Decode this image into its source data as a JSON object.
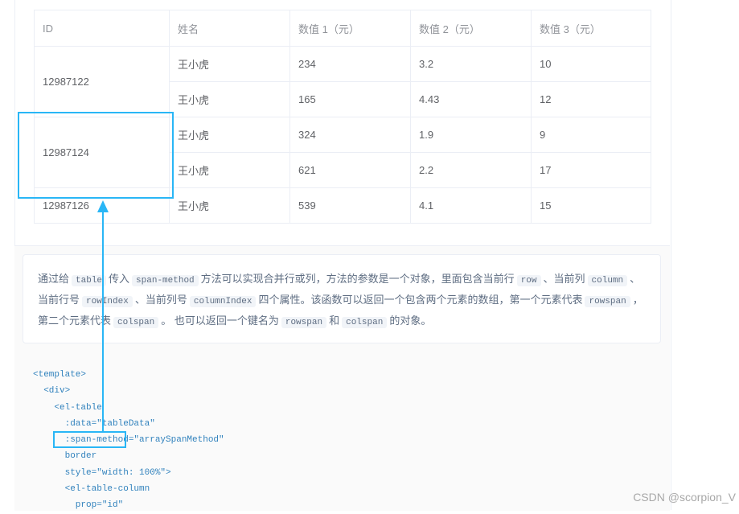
{
  "table": {
    "headers": [
      "ID",
      "姓名",
      "数值 1（元）",
      "数值 2（元）",
      "数值 3（元）"
    ],
    "groups": [
      {
        "id": "12987122",
        "rows": [
          [
            "王小虎",
            "234",
            "3.2",
            "10"
          ],
          [
            "王小虎",
            "165",
            "4.43",
            "12"
          ]
        ]
      },
      {
        "id": "12987124",
        "rows": [
          [
            "王小虎",
            "324",
            "1.9",
            "9"
          ],
          [
            "王小虎",
            "621",
            "2.2",
            "17"
          ]
        ]
      },
      {
        "id": "12987126",
        "rows": [
          [
            "王小虎",
            "539",
            "4.1",
            "15"
          ]
        ]
      }
    ]
  },
  "description": {
    "parts": [
      {
        "t": "通过给"
      },
      {
        "c": "table"
      },
      {
        "t": "传入"
      },
      {
        "c": "span-method"
      },
      {
        "t": "方法可以实现合并行或列，方法的参数是一个对象，里面包含当前行"
      },
      {
        "c": "row"
      },
      {
        "t": "、当前列"
      },
      {
        "c": "column"
      },
      {
        "t": "、当前行号"
      },
      {
        "c": "rowIndex"
      },
      {
        "t": "、当前列号"
      },
      {
        "c": "columnIndex"
      },
      {
        "t": "四个属性。该函数可以返回一个包含两个元素的数组，第一个元素代表"
      },
      {
        "c": "rowspan"
      },
      {
        "t": "，第二个元素代表"
      },
      {
        "c": "colspan"
      },
      {
        "t": "。 也可以返回一个键名为"
      },
      {
        "c": "rowspan"
      },
      {
        "t": "和"
      },
      {
        "c": "colspan"
      },
      {
        "t": "的对象。"
      }
    ]
  },
  "code_lines": [
    "<template>",
    "  <div>",
    "    <el-table",
    "      :data=\"tableData\"",
    "      :span-method=\"arraySpanMethod\"",
    "      border",
    "      style=\"width: 100%\">",
    "      <el-table-column",
    "        prop=\"id\""
  ],
  "watermark": "CSDN @scorpion_V",
  "colors": {
    "highlight": "#29b6f6",
    "border": "#ebeef5"
  }
}
